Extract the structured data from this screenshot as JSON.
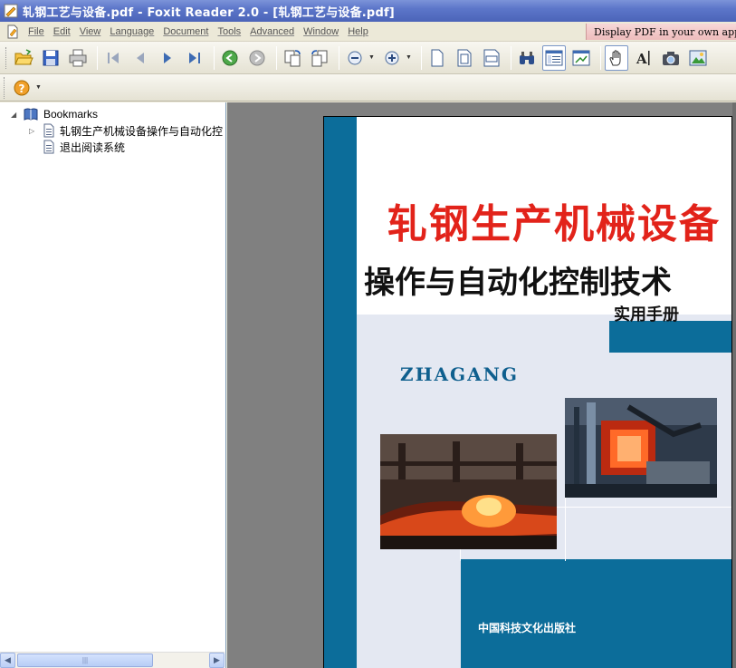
{
  "window": {
    "title": "轧钢工艺与设备.pdf - Foxit Reader 2.0 - [轧钢工艺与设备.pdf]"
  },
  "menu": {
    "items": [
      "File",
      "Edit",
      "View",
      "Language",
      "Document",
      "Tools",
      "Advanced",
      "Window",
      "Help"
    ]
  },
  "ad": {
    "text": "Display PDF in your own appl"
  },
  "toolbar": {
    "icons": [
      "open-icon",
      "save-icon",
      "print-icon",
      "first-page-icon",
      "previous-page-icon",
      "next-page-icon",
      "last-page-icon",
      "go-back-icon",
      "go-forward-icon",
      "rotate-clockwise-icon",
      "rotate-counterclockwise-icon",
      "zoom-out-icon",
      "zoom-in-icon",
      "actual-size-icon",
      "fit-page-icon",
      "fit-width-icon",
      "find-icon",
      "bookmarks-panel-icon",
      "thumbnails-icon",
      "hand-tool-icon",
      "text-select-icon",
      "snapshot-icon",
      "image-tool-icon",
      "help-icon"
    ]
  },
  "bookmarks": {
    "root_label": "Bookmarks",
    "items": [
      {
        "label": "轧钢生产机械设备操作与自动化控",
        "expandable": true
      },
      {
        "label": "退出阅读系统",
        "expandable": false
      }
    ]
  },
  "cover": {
    "title_line1": "轧钢生产机械设备",
    "title_line2": "操作与自动化控制技术",
    "subtitle": "实用手册",
    "brand": "ZHAGANG",
    "publisher": "中国科技文化出版社"
  },
  "colors": {
    "title_bar": "#5c76c9",
    "cover_blue": "#0c6d9a",
    "cover_title_red": "#e2231a",
    "viewer_bg": "#808080"
  }
}
